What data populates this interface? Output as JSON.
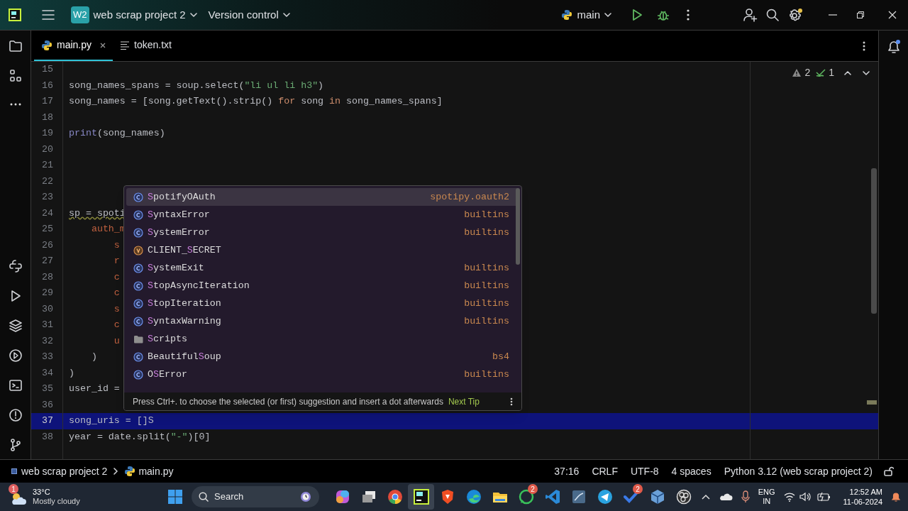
{
  "title_bar": {
    "project_badge": "W2",
    "project": "web scrap project 2",
    "vcs": "Version control",
    "run_config": "main"
  },
  "tabs": [
    {
      "label": "main.py",
      "kind": "python",
      "selected": true,
      "closable": true
    },
    {
      "label": "token.txt",
      "kind": "text",
      "selected": false,
      "closable": false
    }
  ],
  "inspections": {
    "warnings": "2",
    "checks": "1"
  },
  "code_lines": [
    {
      "number": "15",
      "current": false
    },
    {
      "number": "16",
      "current": false,
      "tokens": [
        {
          "kind": "plain",
          "text": "song_names_spans = soup.select("
        },
        {
          "kind": "string",
          "text": "\"li ul li h3\""
        },
        {
          "kind": "plain",
          "text": ")"
        }
      ]
    },
    {
      "number": "17",
      "current": false,
      "tokens": [
        {
          "kind": "plain",
          "text": "song_names = [song.getText().strip() "
        },
        {
          "kind": "keyword",
          "text": "for"
        },
        {
          "kind": "plain",
          "text": " song "
        },
        {
          "kind": "keyword",
          "text": "in"
        },
        {
          "kind": "plain",
          "text": " song_names_spans]"
        }
      ]
    },
    {
      "number": "18",
      "current": false
    },
    {
      "number": "19",
      "current": false,
      "tokens": [
        {
          "kind": "builtin",
          "text": "print"
        },
        {
          "kind": "plain",
          "text": "(song_names)"
        }
      ]
    },
    {
      "number": "20",
      "current": false
    },
    {
      "number": "21",
      "current": false
    },
    {
      "number": "22",
      "current": false
    },
    {
      "number": "23",
      "current": false
    },
    {
      "number": "24",
      "current": false,
      "tokens": [
        {
          "kind": "warned",
          "text": "sp = spoti"
        }
      ]
    },
    {
      "number": "25",
      "current": false,
      "tokens": [
        {
          "kind": "param",
          "text": "    auth_m"
        }
      ]
    },
    {
      "number": "26",
      "current": false,
      "tokens": [
        {
          "kind": "param",
          "text": "        s"
        }
      ]
    },
    {
      "number": "27",
      "current": false,
      "tokens": [
        {
          "kind": "param",
          "text": "        r"
        }
      ]
    },
    {
      "number": "28",
      "current": false,
      "tokens": [
        {
          "kind": "param",
          "text": "        c"
        }
      ]
    },
    {
      "number": "29",
      "current": false,
      "tokens": [
        {
          "kind": "param",
          "text": "        c"
        }
      ]
    },
    {
      "number": "30",
      "current": false,
      "tokens": [
        {
          "kind": "param",
          "text": "        s"
        }
      ]
    },
    {
      "number": "31",
      "current": false,
      "tokens": [
        {
          "kind": "param",
          "text": "        c"
        }
      ]
    },
    {
      "number": "32",
      "current": false,
      "tokens": [
        {
          "kind": "param",
          "text": "        u"
        }
      ]
    },
    {
      "number": "33",
      "current": false,
      "tokens": [
        {
          "kind": "plain",
          "text": "    )"
        }
      ]
    },
    {
      "number": "34",
      "current": false,
      "tokens": [
        {
          "kind": "plain",
          "text": ")"
        }
      ]
    },
    {
      "number": "35",
      "current": false,
      "tokens": [
        {
          "kind": "plain",
          "text": "user_id ="
        }
      ]
    },
    {
      "number": "36",
      "current": false
    },
    {
      "number": "37",
      "current": true,
      "tokens": [
        {
          "kind": "plain",
          "text": "song_uris = []S"
        }
      ]
    },
    {
      "number": "38",
      "current": false,
      "tokens": [
        {
          "kind": "plain",
          "text": "year = date.split("
        },
        {
          "kind": "string",
          "text": "\"-\""
        },
        {
          "kind": "plain",
          "text": ")[0]"
        }
      ]
    }
  ],
  "completion": {
    "items": [
      {
        "kind": "class",
        "match": "S",
        "suffix": "potifyOAuth",
        "module": "spotipy.oauth2",
        "selected": true
      },
      {
        "kind": "class",
        "match": "S",
        "suffix": "yntaxError",
        "module": "builtins",
        "selected": false
      },
      {
        "kind": "class",
        "match": "S",
        "suffix": "ystemError",
        "module": "builtins",
        "selected": false
      },
      {
        "kind": "variable",
        "prefix": "CLIENT_",
        "match": "S",
        "suffix": "ECRET",
        "selected": false
      },
      {
        "kind": "class",
        "match": "S",
        "suffix": "ystemExit",
        "module": "builtins",
        "selected": false
      },
      {
        "kind": "class",
        "match": "S",
        "suffix": "topAsyncIteration",
        "module": "builtins",
        "selected": false
      },
      {
        "kind": "class",
        "match": "S",
        "suffix": "topIteration",
        "module": "builtins",
        "selected": false
      },
      {
        "kind": "class",
        "match": "S",
        "suffix": "yntaxWarning",
        "module": "builtins",
        "selected": false
      },
      {
        "kind": "folder",
        "match": "S",
        "suffix": "cripts",
        "selected": false
      },
      {
        "kind": "class",
        "prefix": "Beautiful",
        "match": "S",
        "suffix": "oup",
        "module": "bs4",
        "selected": false
      },
      {
        "kind": "class",
        "prefix": "O",
        "match": "S",
        "suffix": "Error",
        "module": "builtins",
        "selected": false
      }
    ],
    "hint": "Press Ctrl+. to choose the selected (or first) suggestion and insert a dot afterwards",
    "next_tip": "Next Tip"
  },
  "breadcrumb": [
    "web scrap project 2",
    "main.py"
  ],
  "status": [
    "37:16",
    "CRLF",
    "UTF-8",
    "4 spaces",
    "Python 3.12 (web scrap project 2)"
  ],
  "taskbar": {
    "weather": {
      "badge": "1",
      "temperature": "33°C",
      "condition": "Mostly cloudy"
    },
    "search_placeholder": "Search",
    "apps": [
      {
        "kind": "copilot",
        "active": false
      },
      {
        "kind": "taskview",
        "active": false
      },
      {
        "kind": "chrome",
        "active": false
      },
      {
        "kind": "ide",
        "active": true
      },
      {
        "kind": "brave",
        "active": false
      },
      {
        "kind": "edge",
        "active": false
      },
      {
        "kind": "files",
        "active": false
      },
      {
        "kind": "whatsapp",
        "badge": "2",
        "active": false
      },
      {
        "kind": "vscode",
        "active": false
      },
      {
        "kind": "db",
        "active": false
      },
      {
        "kind": "telegram",
        "active": false
      },
      {
        "kind": "todo",
        "badge": "2",
        "active": false
      },
      {
        "kind": "box",
        "active": false
      },
      {
        "kind": "obs",
        "active": false
      }
    ],
    "language": "ENG",
    "region": "IN",
    "time": "12:52 AM",
    "date": "11-06-2024"
  }
}
